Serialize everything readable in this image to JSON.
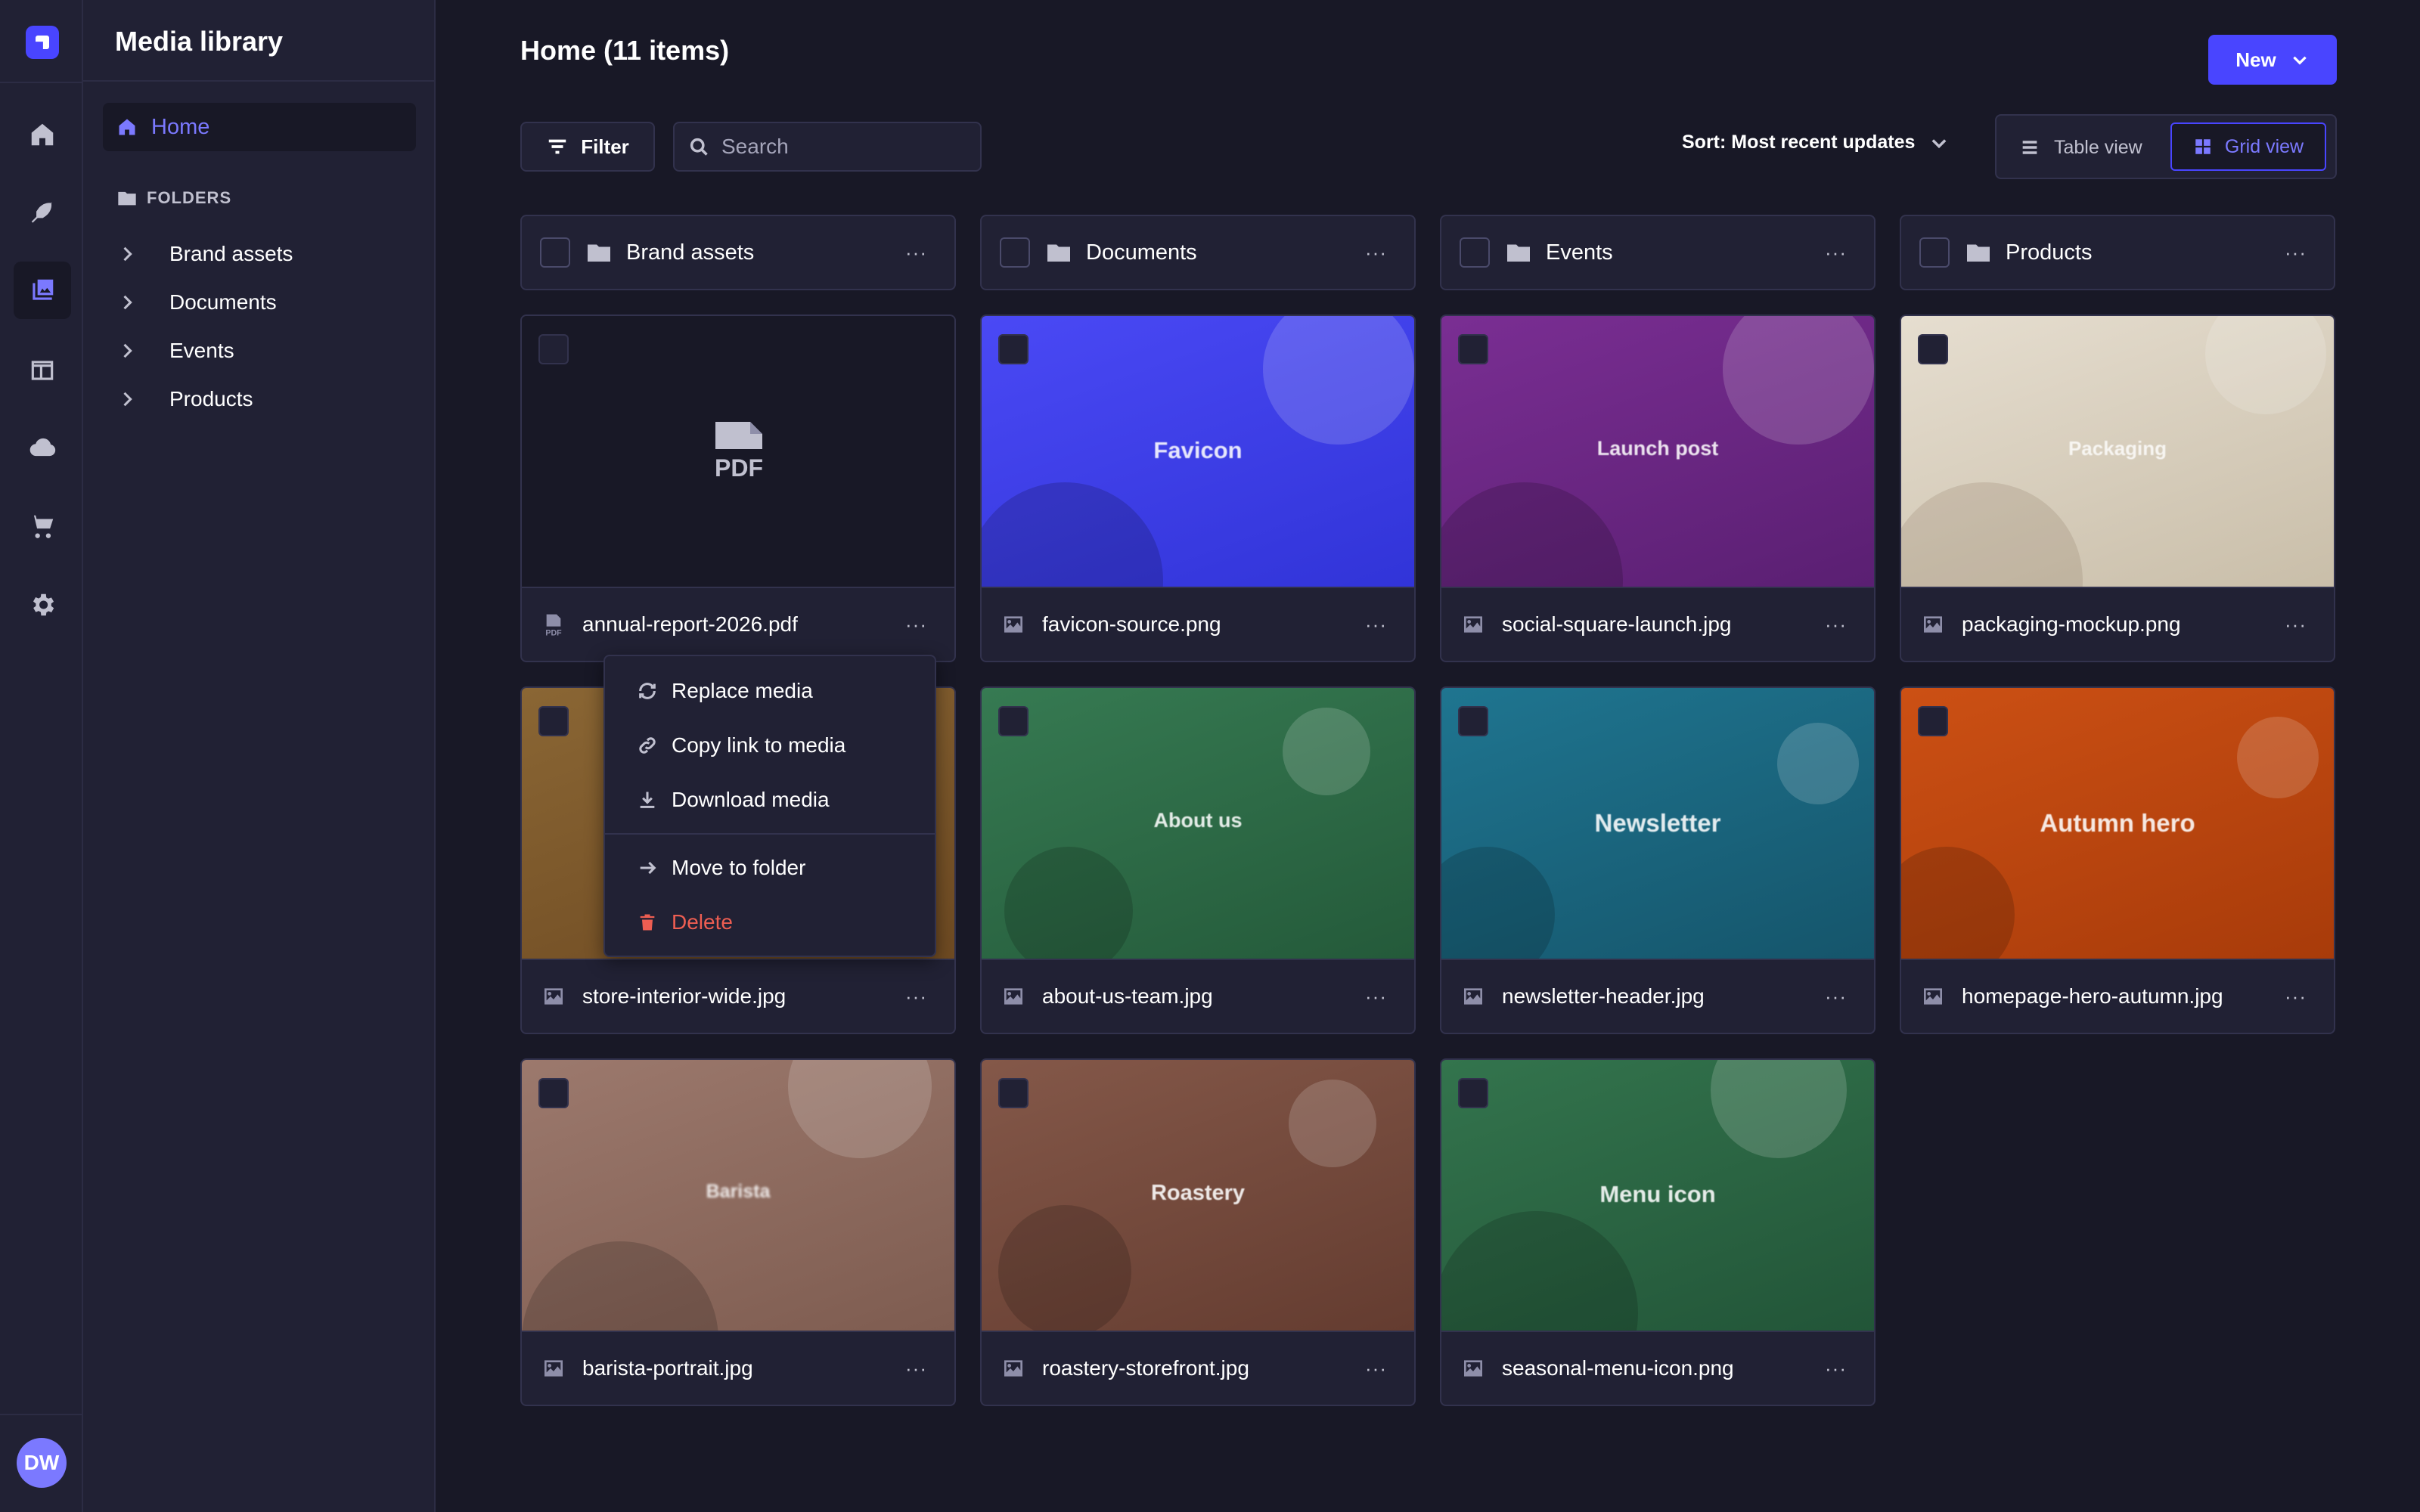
{
  "rail": {
    "items": [
      "home",
      "content-manager",
      "media-library",
      "content-type-builder",
      "cloud",
      "marketplace",
      "settings"
    ],
    "avatar_initials": "DW"
  },
  "subnav": {
    "title": "Media library",
    "home_label": "Home",
    "folders_heading": "FOLDERS",
    "folders": [
      "Brand assets",
      "Documents",
      "Events",
      "Products"
    ]
  },
  "header": {
    "title": "Home (11 items)",
    "new_label": "New"
  },
  "toolbar": {
    "filter_label": "Filter",
    "search_placeholder": "Search",
    "sort_label": "Sort: Most recent updates",
    "table_view_label": "Table view",
    "grid_view_label": "Grid view"
  },
  "folder_cards": [
    "Brand assets",
    "Documents",
    "Events",
    "Products"
  ],
  "assets": [
    {
      "name": "annual-report-2026.pdf",
      "type": "pdf",
      "thumb_text": "PDF"
    },
    {
      "name": "favicon-source.png",
      "type": "image",
      "thumb_text": "Favicon",
      "color": "#4140f0"
    },
    {
      "name": "social-square-launch.jpg",
      "type": "image",
      "thumb_text": "Launch post",
      "color": "#6e2786"
    },
    {
      "name": "packaging-mockup.png",
      "type": "image",
      "thumb_text": "Packaging",
      "color": "#d8cfbf"
    },
    {
      "name": "store-interior-wide.jpg",
      "type": "image",
      "thumb_text": "",
      "color": "#7f5a2c"
    },
    {
      "name": "about-us-team.jpg",
      "type": "image",
      "thumb_text": "About us",
      "color": "#2f6a46"
    },
    {
      "name": "newsletter-header.jpg",
      "type": "image",
      "thumb_text": "Newsletter",
      "color": "#1a6a82"
    },
    {
      "name": "homepage-hero-autumn.jpg",
      "type": "image",
      "thumb_text": "Autumn hero",
      "color": "#c2460f"
    },
    {
      "name": "barista-portrait.jpg",
      "type": "image",
      "thumb_text": "Barista",
      "color": "#8e6a5e"
    },
    {
      "name": "roastery-storefront.jpg",
      "type": "image",
      "thumb_text": "Roastery",
      "color": "#764c40"
    },
    {
      "name": "seasonal-menu-icon.png",
      "type": "image",
      "thumb_text": "Menu icon",
      "color": "#2c6a45"
    }
  ],
  "context_menu": {
    "items": [
      "Replace media",
      "Copy link to media",
      "Download media",
      "Move to folder",
      "Delete"
    ]
  },
  "colors": {
    "accent": "#4945ff",
    "accent_light": "#7b79ff",
    "danger": "#ee5e52",
    "background": "#181826",
    "surface": "#212134"
  }
}
